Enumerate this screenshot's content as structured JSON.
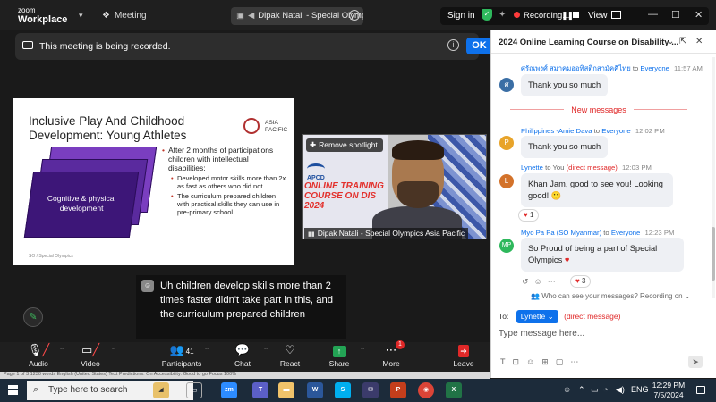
{
  "zoom_bar": {
    "brand_line1": "zoom",
    "brand_line2": "Workplace",
    "meeting_label": "Meeting",
    "title_pill": "Dipak Natali - Special Olymp",
    "sign_in": "Sign in",
    "recording": "Recording...",
    "view": "View",
    "accent": "#0e71eb"
  },
  "banner": {
    "text": "This meeting is being recorded.",
    "ok": "OK"
  },
  "slide": {
    "title": "Inclusive Play And Childhood Development: Young Athletes",
    "logo_text": "ASIA PACIFIC",
    "card_text": "Cognitive & physical development",
    "bullet_main": "After 2 months of participations children with intellectual disabilities:",
    "sub1": "Developed motor skills more than 2x as fast as others who did not.",
    "sub2": "The curriculum prepared children with practical skills they can use in pre-primary school.",
    "footer": "SO / Special Olympics"
  },
  "speaker": {
    "spotlight": "Remove spotlight",
    "name": "Dipak Natali - Special Olympics Asia Pacific",
    "poster_org": "APCD",
    "poster_text": "ONLINE TRAINING COURSE ON DIS 2024"
  },
  "caption": {
    "text": "Uh children develop skills more than 2 times faster didn't take part in this, and the curriculum prepared children"
  },
  "toolbar": {
    "audio": "Audio",
    "video": "Video",
    "participants": "Participants",
    "participants_count": "41",
    "chat": "Chat",
    "react": "React",
    "share": "Share",
    "more": "More",
    "more_badge": "1",
    "leave": "Leave"
  },
  "chat": {
    "title": "2024 Online Learning Course on Disability ...",
    "messages": [
      {
        "sender": "ศรัณพงศ์ สมาคมออทิสติกสามัคคีไทย",
        "to": "to",
        "recipient": "Everyone",
        "time": "11:57 AM",
        "initial": "ศ",
        "color": "#3a6ea5",
        "text": "Thank you so much"
      },
      {
        "sender": "Philippines -Amie Dava",
        "to": "to",
        "recipient": "Everyone",
        "time": "12:02 PM",
        "initial": "P",
        "color": "#e8a42a",
        "text": "Thank you so much"
      },
      {
        "sender": "Lynette",
        "to": "to You",
        "recipient": "(direct message)",
        "time": "12:03 PM",
        "initial": "L",
        "color": "#d3722a",
        "text": "Khan Jam, good to see you! Looking good! 🙂",
        "reaction": "1"
      },
      {
        "sender": "Myo Pa Pa (SO Myanmar)",
        "to": "to",
        "recipient": "Everyone",
        "time": "12:23 PM",
        "initial": "MP",
        "color": "#2eb85c",
        "text": "So Proud of being a part of Special Olympics",
        "reaction": "3"
      }
    ],
    "new_messages": "New messages",
    "who_can_see": "Who can see your messages? Recording on",
    "to_label": "To:",
    "to_pill": "Lynette",
    "to_dm": "(direct message)",
    "input_placeholder": "Type message here..."
  },
  "statusbar": {
    "text": "Page 1 of 3    1230 words    English (United States)    Text Predictions: On    Accessibility: Good to go    Focus    100%"
  },
  "taskbar": {
    "search_placeholder": "Type here to search",
    "lang": "ENG",
    "time": "12:29 PM",
    "date": "7/5/2024"
  }
}
